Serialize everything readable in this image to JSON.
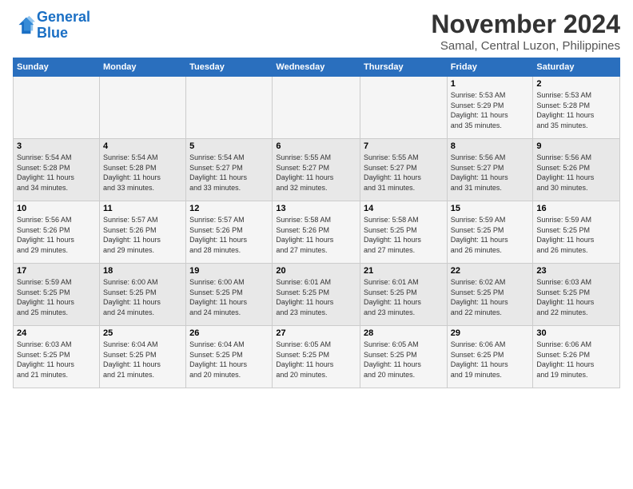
{
  "header": {
    "logo_line1": "General",
    "logo_line2": "Blue",
    "month_title": "November 2024",
    "location": "Samal, Central Luzon, Philippines"
  },
  "days_of_week": [
    "Sunday",
    "Monday",
    "Tuesday",
    "Wednesday",
    "Thursday",
    "Friday",
    "Saturday"
  ],
  "weeks": [
    [
      {
        "day": "",
        "info": ""
      },
      {
        "day": "",
        "info": ""
      },
      {
        "day": "",
        "info": ""
      },
      {
        "day": "",
        "info": ""
      },
      {
        "day": "",
        "info": ""
      },
      {
        "day": "1",
        "info": "Sunrise: 5:53 AM\nSunset: 5:29 PM\nDaylight: 11 hours\nand 35 minutes."
      },
      {
        "day": "2",
        "info": "Sunrise: 5:53 AM\nSunset: 5:28 PM\nDaylight: 11 hours\nand 35 minutes."
      }
    ],
    [
      {
        "day": "3",
        "info": "Sunrise: 5:54 AM\nSunset: 5:28 PM\nDaylight: 11 hours\nand 34 minutes."
      },
      {
        "day": "4",
        "info": "Sunrise: 5:54 AM\nSunset: 5:28 PM\nDaylight: 11 hours\nand 33 minutes."
      },
      {
        "day": "5",
        "info": "Sunrise: 5:54 AM\nSunset: 5:27 PM\nDaylight: 11 hours\nand 33 minutes."
      },
      {
        "day": "6",
        "info": "Sunrise: 5:55 AM\nSunset: 5:27 PM\nDaylight: 11 hours\nand 32 minutes."
      },
      {
        "day": "7",
        "info": "Sunrise: 5:55 AM\nSunset: 5:27 PM\nDaylight: 11 hours\nand 31 minutes."
      },
      {
        "day": "8",
        "info": "Sunrise: 5:56 AM\nSunset: 5:27 PM\nDaylight: 11 hours\nand 31 minutes."
      },
      {
        "day": "9",
        "info": "Sunrise: 5:56 AM\nSunset: 5:26 PM\nDaylight: 11 hours\nand 30 minutes."
      }
    ],
    [
      {
        "day": "10",
        "info": "Sunrise: 5:56 AM\nSunset: 5:26 PM\nDaylight: 11 hours\nand 29 minutes."
      },
      {
        "day": "11",
        "info": "Sunrise: 5:57 AM\nSunset: 5:26 PM\nDaylight: 11 hours\nand 29 minutes."
      },
      {
        "day": "12",
        "info": "Sunrise: 5:57 AM\nSunset: 5:26 PM\nDaylight: 11 hours\nand 28 minutes."
      },
      {
        "day": "13",
        "info": "Sunrise: 5:58 AM\nSunset: 5:26 PM\nDaylight: 11 hours\nand 27 minutes."
      },
      {
        "day": "14",
        "info": "Sunrise: 5:58 AM\nSunset: 5:25 PM\nDaylight: 11 hours\nand 27 minutes."
      },
      {
        "day": "15",
        "info": "Sunrise: 5:59 AM\nSunset: 5:25 PM\nDaylight: 11 hours\nand 26 minutes."
      },
      {
        "day": "16",
        "info": "Sunrise: 5:59 AM\nSunset: 5:25 PM\nDaylight: 11 hours\nand 26 minutes."
      }
    ],
    [
      {
        "day": "17",
        "info": "Sunrise: 5:59 AM\nSunset: 5:25 PM\nDaylight: 11 hours\nand 25 minutes."
      },
      {
        "day": "18",
        "info": "Sunrise: 6:00 AM\nSunset: 5:25 PM\nDaylight: 11 hours\nand 24 minutes."
      },
      {
        "day": "19",
        "info": "Sunrise: 6:00 AM\nSunset: 5:25 PM\nDaylight: 11 hours\nand 24 minutes."
      },
      {
        "day": "20",
        "info": "Sunrise: 6:01 AM\nSunset: 5:25 PM\nDaylight: 11 hours\nand 23 minutes."
      },
      {
        "day": "21",
        "info": "Sunrise: 6:01 AM\nSunset: 5:25 PM\nDaylight: 11 hours\nand 23 minutes."
      },
      {
        "day": "22",
        "info": "Sunrise: 6:02 AM\nSunset: 5:25 PM\nDaylight: 11 hours\nand 22 minutes."
      },
      {
        "day": "23",
        "info": "Sunrise: 6:03 AM\nSunset: 5:25 PM\nDaylight: 11 hours\nand 22 minutes."
      }
    ],
    [
      {
        "day": "24",
        "info": "Sunrise: 6:03 AM\nSunset: 5:25 PM\nDaylight: 11 hours\nand 21 minutes."
      },
      {
        "day": "25",
        "info": "Sunrise: 6:04 AM\nSunset: 5:25 PM\nDaylight: 11 hours\nand 21 minutes."
      },
      {
        "day": "26",
        "info": "Sunrise: 6:04 AM\nSunset: 5:25 PM\nDaylight: 11 hours\nand 20 minutes."
      },
      {
        "day": "27",
        "info": "Sunrise: 6:05 AM\nSunset: 5:25 PM\nDaylight: 11 hours\nand 20 minutes."
      },
      {
        "day": "28",
        "info": "Sunrise: 6:05 AM\nSunset: 5:25 PM\nDaylight: 11 hours\nand 20 minutes."
      },
      {
        "day": "29",
        "info": "Sunrise: 6:06 AM\nSunset: 6:25 PM\nDaylight: 11 hours\nand 19 minutes."
      },
      {
        "day": "30",
        "info": "Sunrise: 6:06 AM\nSunset: 5:26 PM\nDaylight: 11 hours\nand 19 minutes."
      }
    ]
  ]
}
